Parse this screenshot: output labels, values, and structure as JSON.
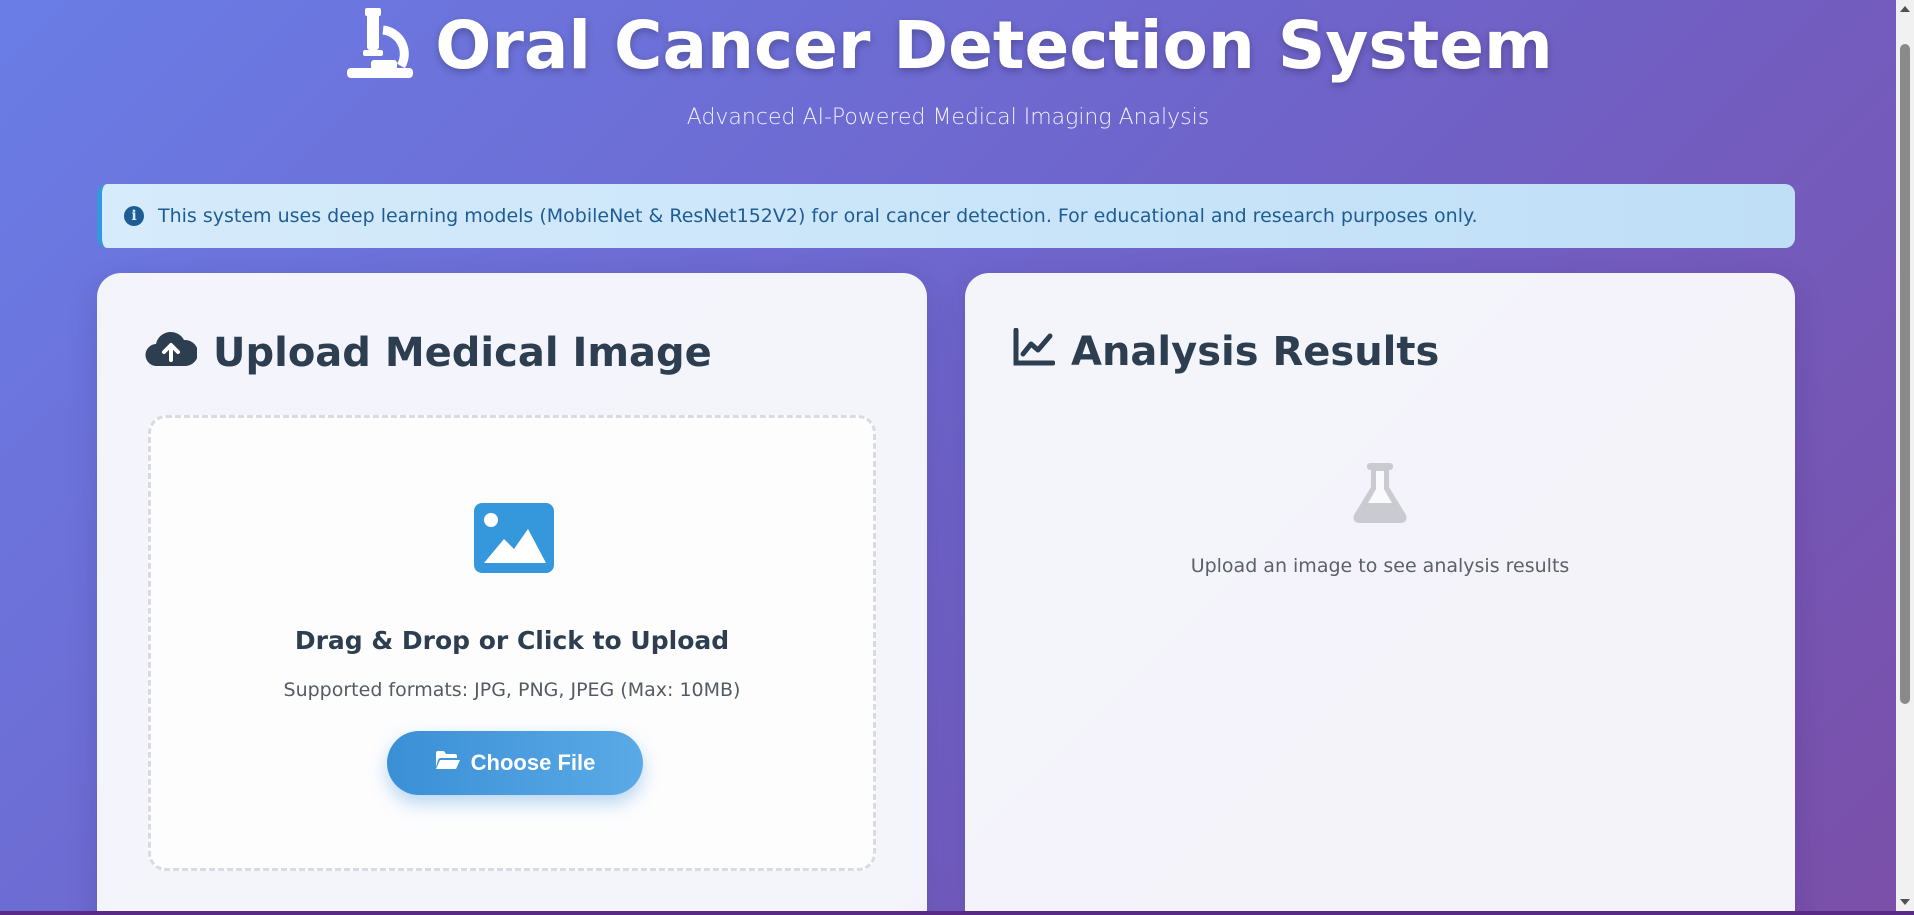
{
  "header": {
    "title": "Oral Cancer Detection System",
    "subtitle": "Advanced AI-Powered Medical Imaging Analysis",
    "icon": "microscope-icon"
  },
  "info_banner": {
    "icon": "info-icon",
    "text": "This system uses deep learning models (MobileNet & ResNet152V2) for oral cancer detection. For educational and research purposes only."
  },
  "upload_card": {
    "heading": "Upload Medical Image",
    "heading_icon": "cloud-upload-icon",
    "dropzone": {
      "icon": "image-icon",
      "title": "Drag & Drop or Click to Upload",
      "formats": "Supported formats: JPG, PNG, JPEG (Max: 10MB)",
      "button_label": "Choose File",
      "button_icon": "folder-open-icon"
    }
  },
  "results_card": {
    "heading": "Analysis Results",
    "heading_icon": "chart-line-icon",
    "empty_icon": "flask-icon",
    "empty_message": "Upload an image to see analysis results"
  },
  "colors": {
    "accent": "#3598dc",
    "text_dark": "#2c3e50",
    "banner_text": "#1e5d94"
  }
}
